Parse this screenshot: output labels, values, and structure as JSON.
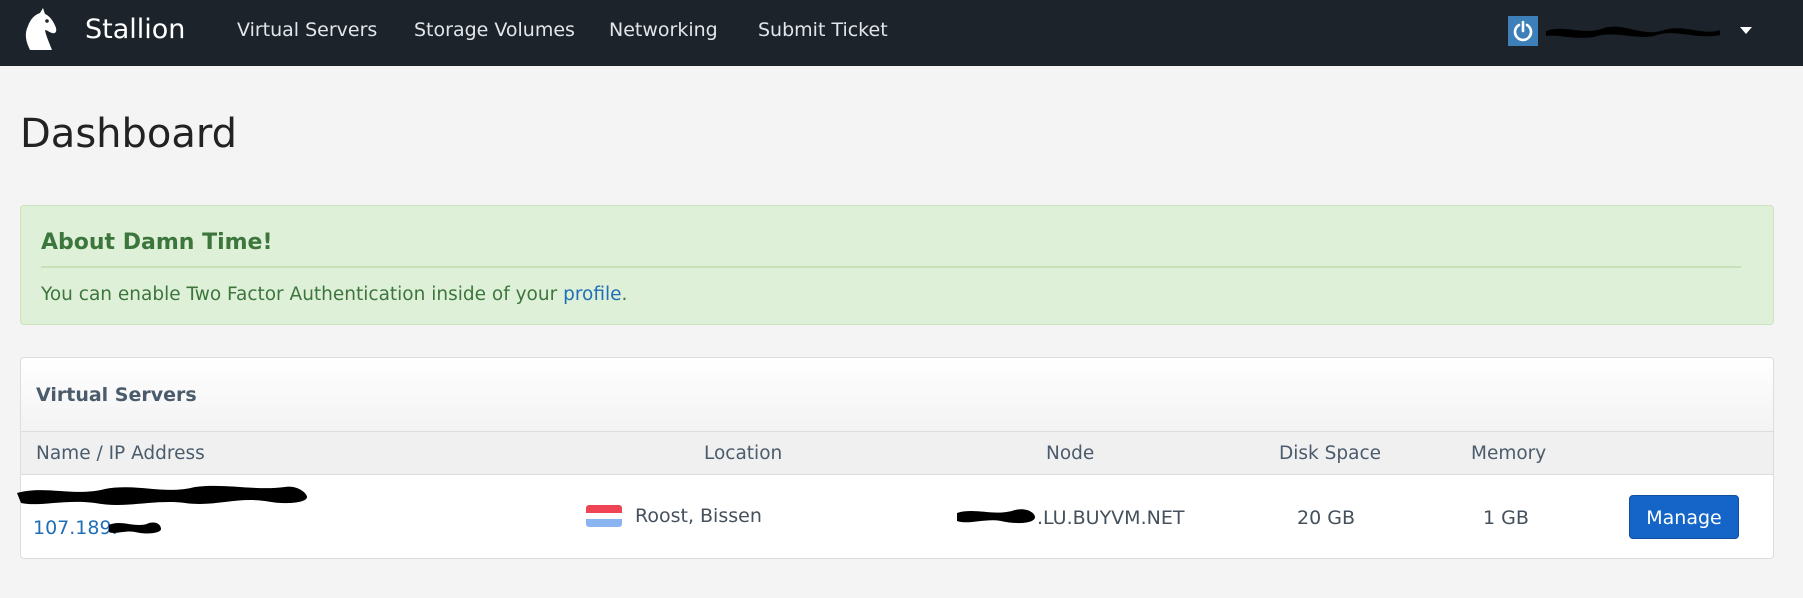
{
  "brand": {
    "name": "Stallion",
    "logo_icon": "horse-head-icon"
  },
  "nav": [
    {
      "label": "Virtual Servers"
    },
    {
      "label": "Storage Volumes"
    },
    {
      "label": "Networking"
    },
    {
      "label": "Submit Ticket"
    }
  ],
  "user_menu": {
    "icon": "power-icon",
    "name_redacted": true
  },
  "page": {
    "title": "Dashboard"
  },
  "alert": {
    "heading": "About Damn Time!",
    "text_before": "You can enable Two Factor Authentication inside of your ",
    "link": "profile",
    "text_after": "."
  },
  "servers_panel": {
    "title": "Virtual Servers",
    "columns": [
      "Name / IP Address",
      "Location",
      "Node",
      "Disk Space",
      "Memory"
    ],
    "rows": [
      {
        "ip_prefix": "107.189.",
        "location": "Roost, Bissen",
        "flag": "luxembourg-flag",
        "node_suffix": ".LU.BUYVM.NET",
        "disk": "20 GB",
        "memory": "1 GB",
        "action": "Manage"
      }
    ]
  },
  "colors": {
    "navbar": "#1c232b",
    "alert_bg": "#dff0d8",
    "alert_text": "#3c763d",
    "link": "#1f6fb6",
    "primary_button": "#1565c8"
  }
}
